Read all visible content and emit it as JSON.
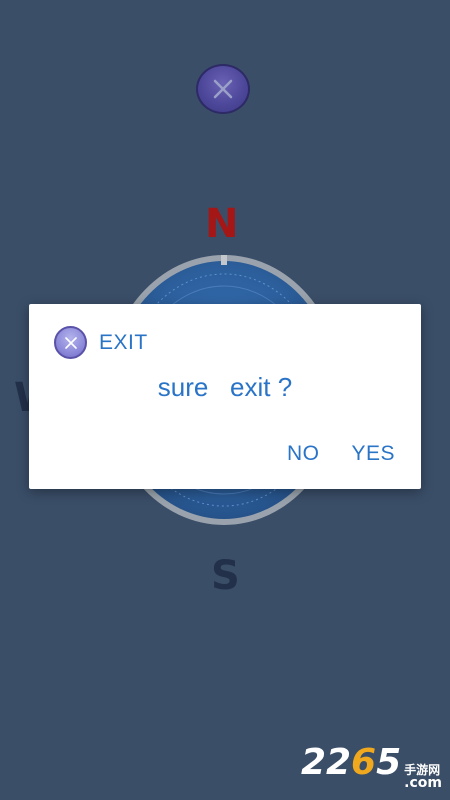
{
  "app": {
    "top_close_icon": "close-x-icon"
  },
  "compass": {
    "north_label": "N",
    "south_label": "S",
    "west_label": "W",
    "north_color": "#a51616",
    "dial_color": "#2d5f9e"
  },
  "dialog": {
    "icon": "close-x-icon",
    "title": "EXIT",
    "message": "sure   exit ?",
    "no_label": "NO",
    "yes_label": "YES",
    "accent_color": "#2a74c8"
  },
  "watermark": {
    "digits_white": "22",
    "digit_accent": "6",
    "digit_last": "5",
    "cn_text": "手游网",
    "com_text": ".com"
  }
}
